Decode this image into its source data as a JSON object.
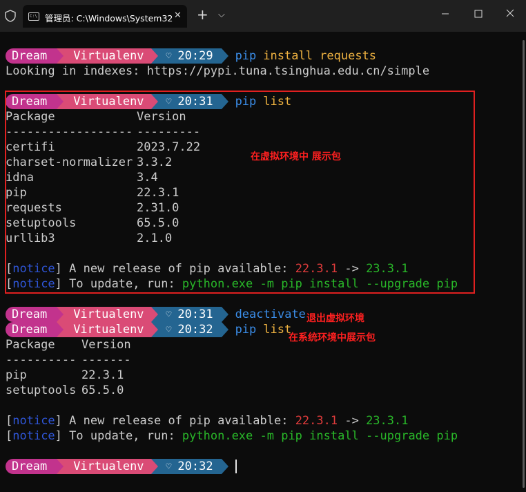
{
  "window": {
    "tab_title": "管理员: C:\\Windows\\System32",
    "tab_close": "✕",
    "new_tab": "+",
    "dropdown": "⌵",
    "minimize": "—",
    "maximize": "☐",
    "close": "✕"
  },
  "prompt": {
    "user": "Dream",
    "env": "Virtualenv",
    "heart": "♡"
  },
  "blocks": {
    "b1": {
      "time": "20:29",
      "cmd_name": "pip",
      "cmd_args": "install requests",
      "output": "Looking in indexes: https://pypi.tuna.tsinghua.edu.cn/simple"
    },
    "b2": {
      "time": "20:31",
      "cmd_name": "pip",
      "cmd_args": "list",
      "header_pkg": "Package",
      "header_ver": "Version",
      "sep_pkg": "------------------",
      "sep_ver": "---------",
      "packages": [
        {
          "name": "certifi",
          "version": "2023.7.22"
        },
        {
          "name": "charset-normalizer",
          "version": "3.3.2"
        },
        {
          "name": "idna",
          "version": "3.4"
        },
        {
          "name": "pip",
          "version": "22.3.1"
        },
        {
          "name": "requests",
          "version": "2.31.0"
        },
        {
          "name": "setuptools",
          "version": "65.5.0"
        },
        {
          "name": "urllib3",
          "version": "2.1.0"
        }
      ]
    },
    "b3": {
      "time": "20:31",
      "cmd_name": "deactivate"
    },
    "b4": {
      "time": "20:32",
      "cmd_name": "pip",
      "cmd_args": "list",
      "header_pkg": "Package",
      "header_ver": "Version",
      "sep_pkg": "----------",
      "sep_ver": "-------",
      "packages": [
        {
          "name": "pip",
          "version": "22.3.1"
        },
        {
          "name": "setuptools",
          "version": "65.5.0"
        }
      ]
    },
    "b5": {
      "time": "20:32"
    }
  },
  "notice": {
    "open": "[",
    "tag": "notice",
    "close": "]",
    "release_text": " A new release of pip available: ",
    "old_version": "22.3.1",
    "arrow": " -> ",
    "new_version": "23.3.1",
    "update_text": " To update, run: ",
    "update_cmd": "python.exe -m pip install --upgrade pip"
  },
  "annotations": {
    "show_in_venv": "在虚拟环境中 展示包",
    "exit_venv": "退出虚拟环境",
    "show_in_system": "在系统环境中展示包"
  },
  "colors": {
    "segment_user": "#c2338d",
    "segment_env": "#da4b76",
    "segment_time": "#246591",
    "command": "#3b8eea",
    "args": "#f0b341",
    "notice": "#2f56d8",
    "old_version": "#e23c3c",
    "new_version": "#29b829",
    "annotation": "#ff2020"
  }
}
